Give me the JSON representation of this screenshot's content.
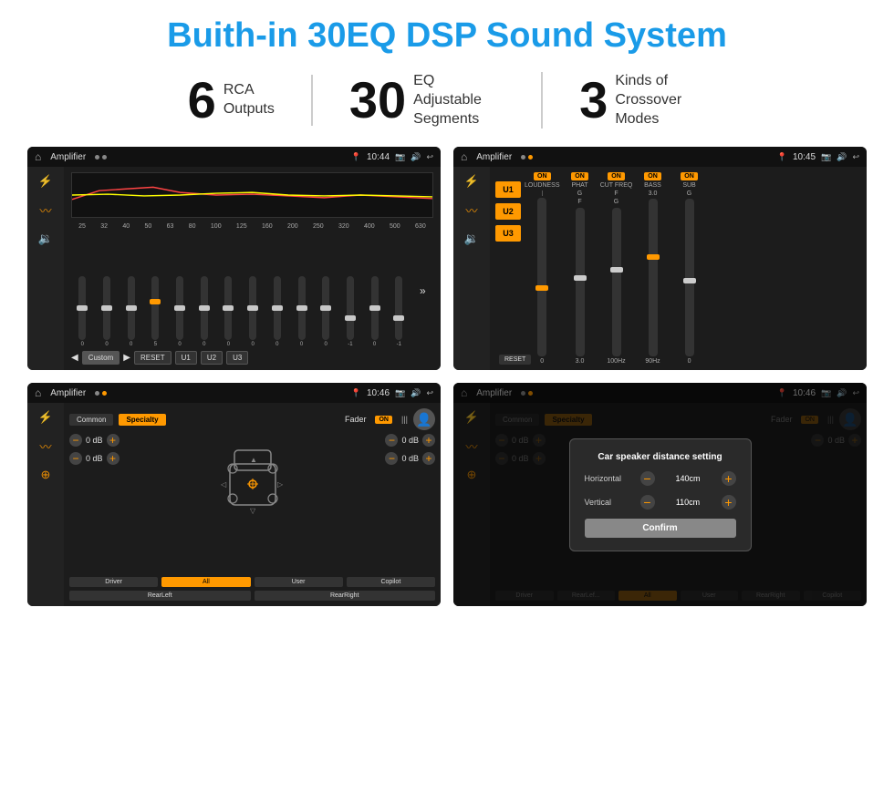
{
  "title": "Buith-in 30EQ DSP Sound System",
  "stats": [
    {
      "number": "6",
      "label_line1": "RCA",
      "label_line2": "Outputs"
    },
    {
      "number": "30",
      "label_line1": "EQ Adjustable",
      "label_line2": "Segments"
    },
    {
      "number": "3",
      "label_line1": "Kinds of",
      "label_line2": "Crossover Modes"
    }
  ],
  "screens": [
    {
      "id": "eq-screen",
      "title": "Amplifier",
      "time": "10:44",
      "type": "eq",
      "freqs": [
        "25",
        "32",
        "40",
        "50",
        "63",
        "80",
        "100",
        "125",
        "160",
        "200",
        "250",
        "320",
        "400",
        "500",
        "630"
      ],
      "values": [
        "0",
        "0",
        "0",
        "5",
        "0",
        "0",
        "0",
        "0",
        "0",
        "0",
        "0",
        "-1",
        "0",
        "-1"
      ],
      "buttons": [
        "Custom",
        "RESET",
        "U1",
        "U2",
        "U3"
      ]
    },
    {
      "id": "amp-screen",
      "title": "Amplifier",
      "time": "10:45",
      "type": "amp",
      "u_buttons": [
        "U1",
        "U2",
        "U3"
      ],
      "channels": [
        "LOUDNESS",
        "PHAT",
        "CUT FREQ",
        "BASS",
        "SUB"
      ]
    },
    {
      "id": "fader-screen",
      "title": "Amplifier",
      "time": "10:46",
      "type": "fader",
      "tabs": [
        "Common",
        "Specialty"
      ],
      "active_tab": "Specialty",
      "fader_label": "Fader",
      "fader_on": "ON",
      "locations": [
        "Driver",
        "RearLeft",
        "All",
        "User",
        "RearRight",
        "Copilot"
      ],
      "db_values": [
        "0 dB",
        "0 dB",
        "0 dB",
        "0 dB"
      ]
    },
    {
      "id": "dialog-screen",
      "title": "Amplifier",
      "time": "10:46",
      "type": "dialog",
      "tabs": [
        "Common",
        "Specialty"
      ],
      "active_tab": "Specialty",
      "dialog": {
        "title": "Car speaker distance setting",
        "horizontal_label": "Horizontal",
        "horizontal_value": "140cm",
        "vertical_label": "Vertical",
        "vertical_value": "110cm",
        "confirm_label": "Confirm"
      },
      "locations": [
        "Driver",
        "RearLef...",
        "All",
        "User",
        "RearRight",
        "Copilot"
      ],
      "db_values": [
        "0 dB",
        "0 dB"
      ]
    }
  ]
}
